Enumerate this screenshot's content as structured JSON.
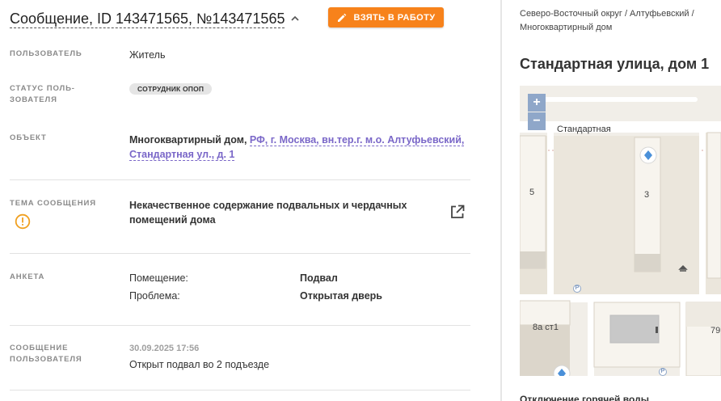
{
  "header": {
    "title": "Сообщение, ID 143471565, №143471565",
    "take_button": "ВЗЯТЬ В РАБОТУ"
  },
  "fields": {
    "user": {
      "label": "ПОЛЬЗОВАТЕЛЬ",
      "value": "Житель"
    },
    "user_status": {
      "label_line1": "СТАТУС ПОЛЬ-",
      "label_line2": "ЗОВАТЕЛЯ",
      "badge": "СОТРУДНИК ОПОП"
    },
    "object": {
      "label": "ОБЪЕКТ",
      "type": "Многоквартирный дом,",
      "link_line1": "РФ, г. Москва, вн.тер.г. м.о. Алтуфьевский,",
      "link_line2": "Стандартная ул., д. 1"
    },
    "topic": {
      "label": "ТЕМА СООБЩЕНИЯ",
      "value_line1": "Некачественное содержание подвальных и чердачных",
      "value_line2": "помещений дома"
    },
    "survey": {
      "label": "АНКЕТА",
      "rows": [
        {
          "key": "Помещение:",
          "value": "Подвал"
        },
        {
          "key": "Проблема:",
          "value": "Открытая дверь"
        }
      ]
    },
    "message": {
      "label_line1": "СООБЩЕНИЕ",
      "label_line2": "ПОЛЬЗОВАТЕЛЯ",
      "date": "30.09.2025 17:56",
      "text": "Открыт подвал во 2 подъезде"
    }
  },
  "right": {
    "breadcrumb_line1": "Северо-Восточный округ / Алтуфьевский /",
    "breadcrumb_line2": "Многоквартирный дом",
    "address": "Стандартная улица, дом 1",
    "map": {
      "zoom_in": "+",
      "zoom_out": "−",
      "street": "Стандартная",
      "house_5": "5",
      "house_3": "3",
      "house_8a": "8а ст1",
      "house_79": "79",
      "parking_1": "P",
      "parking_2": "P"
    },
    "bottom_text": "Отключение горячей воды"
  },
  "colors": {
    "accent": "#f7821b",
    "link": "#7a67c8",
    "warning": "#f0a020",
    "map_control": "#8fa7c9"
  }
}
